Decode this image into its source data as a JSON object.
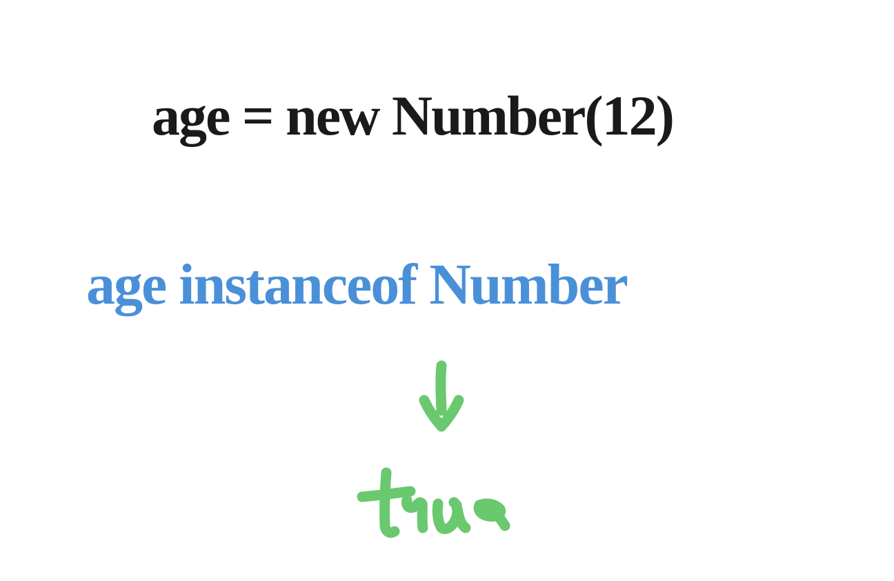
{
  "diagram": {
    "line1": {
      "text": "age = new Number(12)",
      "color": "#1a1a1a"
    },
    "line2": {
      "text": "age instanceof Number",
      "color": "#4a90d9"
    },
    "arrow": {
      "color": "#6ac86e"
    },
    "line3": {
      "text": "true",
      "color": "#6ac86e"
    }
  }
}
